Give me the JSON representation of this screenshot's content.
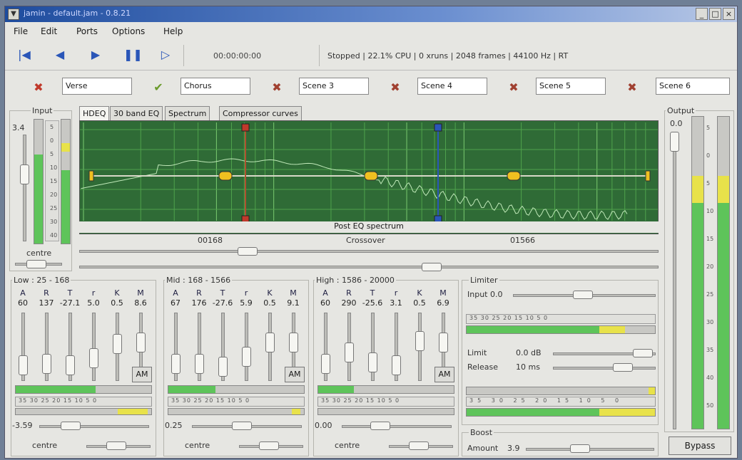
{
  "window": {
    "title": "jamin - default.jam - 0.8.21"
  },
  "menu": {
    "file": "File",
    "edit": "Edit",
    "ports": "Ports",
    "options": "Options",
    "help": "Help"
  },
  "transport": {
    "time": "00:00:00:00",
    "status": "Stopped  |  22.1% CPU  |  0 xruns  |  2048 frames  |  44100 Hz  |  RT"
  },
  "scenes": [
    "Verse",
    "Chorus",
    "Scene 3",
    "Scene 4",
    "Scene 5",
    "Scene 6"
  ],
  "input": {
    "label": "Input",
    "value": "3.4",
    "pan_label": "centre",
    "level": 0.72,
    "scale": [
      "5",
      "0",
      "5",
      "10",
      "15",
      "20",
      "25",
      "30",
      "40"
    ]
  },
  "tabs": [
    "HDEQ",
    "30 band EQ",
    "Spectrum",
    "Compressor curves"
  ],
  "eq": {
    "caption": "Post EQ spectrum",
    "crossover_label": "Crossover",
    "xo_low": "00168",
    "xo_high": "01566"
  },
  "bands": [
    {
      "title": "Low : 25 - 168",
      "params": [
        "A",
        "R",
        "T",
        "r",
        "K",
        "M"
      ],
      "values": [
        "60",
        "137",
        "-27.1",
        "5.0",
        "0.5",
        "8.6"
      ],
      "gain": "-3.59",
      "pan": "centre",
      "am": "AM"
    },
    {
      "title": "Mid : 168 - 1566",
      "params": [
        "A",
        "R",
        "T",
        "r",
        "K",
        "M"
      ],
      "values": [
        "67",
        "176",
        "-27.6",
        "5.9",
        "0.5",
        "9.1"
      ],
      "gain": "0.25",
      "pan": "centre",
      "am": "AM"
    },
    {
      "title": "High : 1586 - 20000",
      "params": [
        "A",
        "R",
        "T",
        "r",
        "K",
        "M"
      ],
      "values": [
        "60",
        "290",
        "-25.6",
        "3.1",
        "0.5",
        "6.9"
      ],
      "gain": "0.00",
      "pan": "centre",
      "am": "AM"
    }
  ],
  "scale_ticks": "35  30  25  20  15  10  5  0",
  "limiter": {
    "title": "Limiter",
    "input_label": "Input",
    "input_value": "0.0",
    "limit_label": "Limit",
    "limit_value": "0.0 dB",
    "release_label": "Release",
    "release_value": "10 ms",
    "scale_ticks": "35  30  25  20  15  10  5  0"
  },
  "boost": {
    "title": "Boost",
    "amount_label": "Amount",
    "amount_value": "3.9"
  },
  "output": {
    "label": "Output",
    "value": "0.0",
    "bypass": "Bypass",
    "scale": [
      "5",
      "0",
      "5",
      "10",
      "15",
      "20",
      "25",
      "30",
      "35",
      "40",
      "50"
    ]
  },
  "colors": {
    "eq_bg": "#2f6b36",
    "meter_green": "#5ec45a",
    "meter_yellow": "#e8e24a",
    "transport_blue": "#2a56b8",
    "close_red": "#c0392b",
    "check_green": "#6a9a2a"
  }
}
